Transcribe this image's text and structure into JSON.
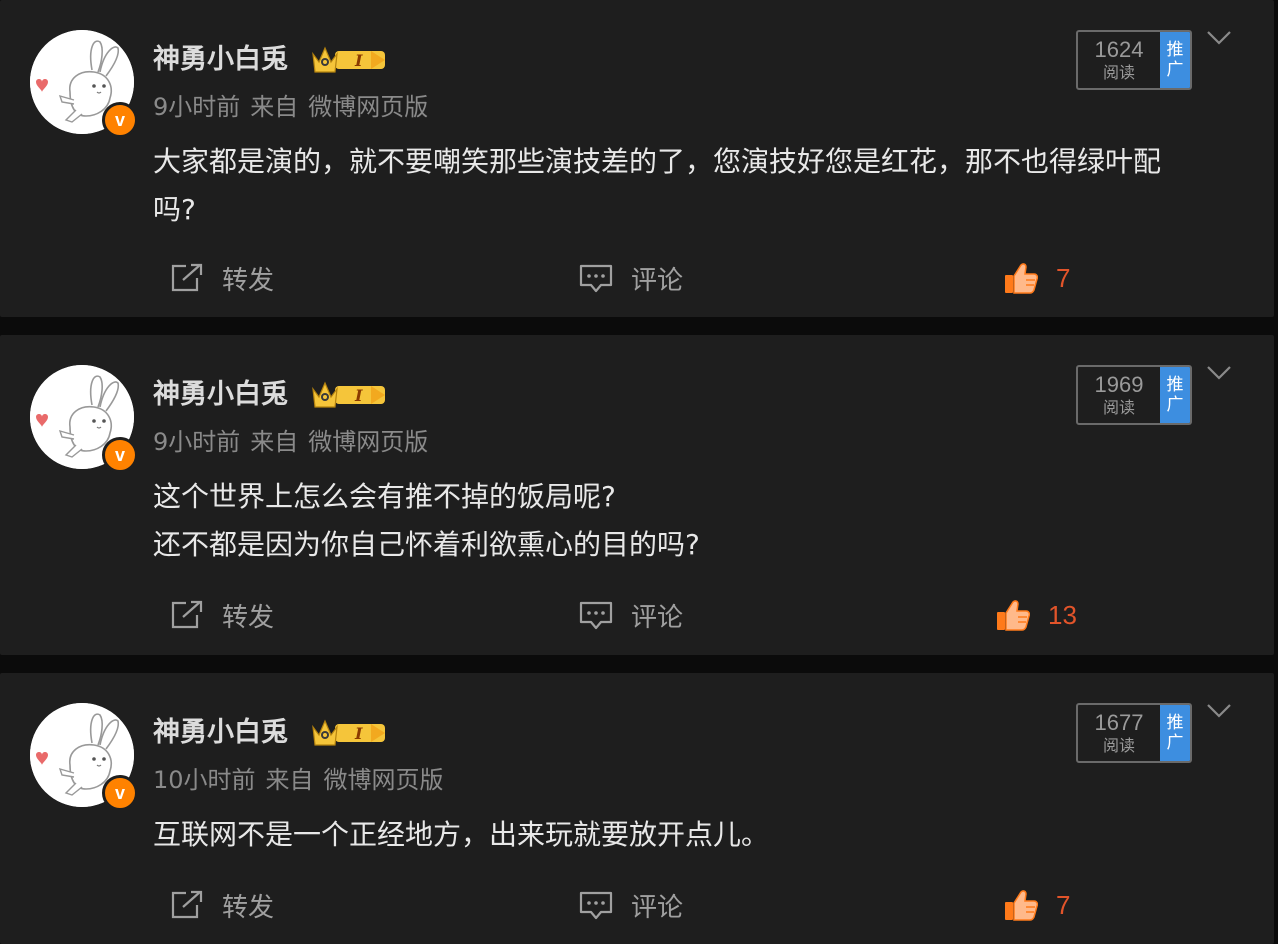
{
  "posts": [
    {
      "username": "神勇小白兎",
      "time": "9小时前",
      "source_prefix": "来自",
      "source": "微博网页版",
      "content": "大家都是演的，就不要嘲笑那些演技差的了，您演技好您是红花，那不也得绿叶配\n吗?",
      "reads": "1624",
      "reads_label": "阅读",
      "promo_label": "推广",
      "repost_label": "转发",
      "comment_label": "评论",
      "likes": "7"
    },
    {
      "username": "神勇小白兎",
      "time": "9小时前",
      "source_prefix": "来自",
      "source": "微博网页版",
      "content": "这个世界上怎么会有推不掉的饭局呢?\n还不都是因为你自己怀着利欲熏心的目的吗?",
      "reads": "1969",
      "reads_label": "阅读",
      "promo_label": "推广",
      "repost_label": "转发",
      "comment_label": "评论",
      "likes": "13"
    },
    {
      "username": "神勇小白兎",
      "time": "10小时前",
      "source_prefix": "来自",
      "source": "微博网页版",
      "content": "互联网不是一个正经地方，出来玩就要放开点儿。",
      "reads": "1677",
      "reads_label": "阅读",
      "promo_label": "推广",
      "repost_label": "转发",
      "comment_label": "评论",
      "likes": "7"
    }
  ],
  "icons": {
    "verified": "v-badge-icon",
    "crown": "member-crown-icon",
    "repost": "repost-icon",
    "comment": "comment-icon",
    "like": "thumbs-up-icon",
    "menu": "chevron-down-icon"
  },
  "colors": {
    "background": "#0b0b0b",
    "card": "#1e1e1e",
    "like": "#e2542a",
    "verified": "#ff8200",
    "promo": "#3d8ee0"
  }
}
